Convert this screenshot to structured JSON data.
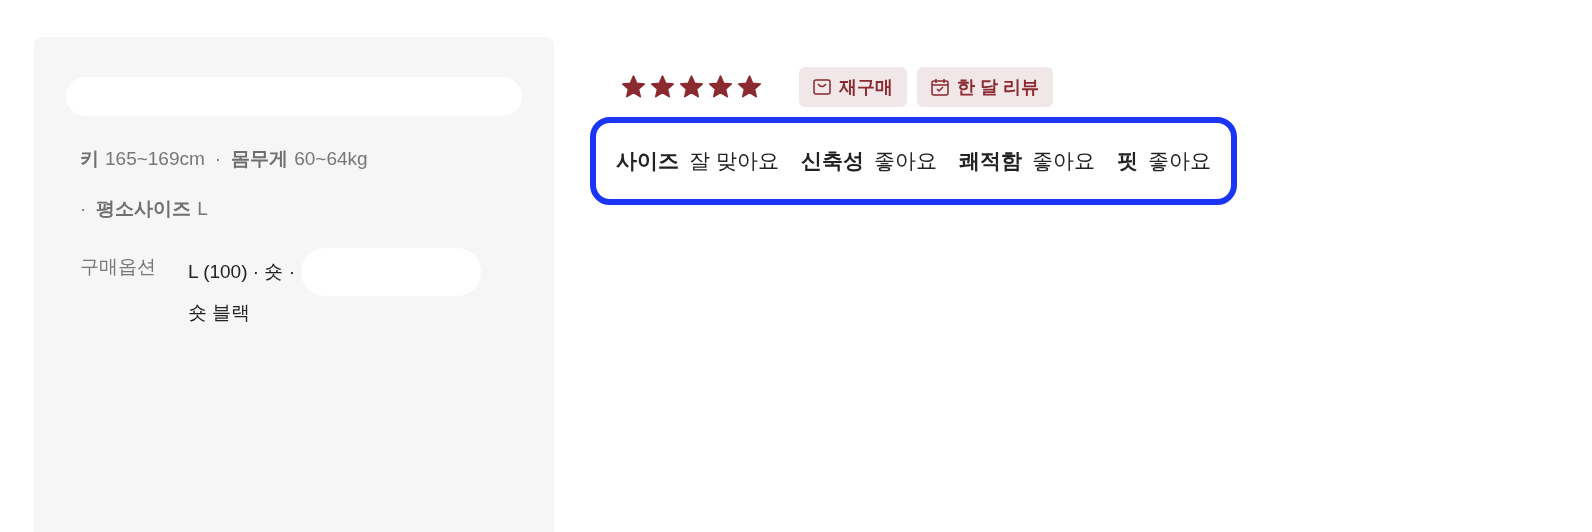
{
  "profile": {
    "stats": [
      {
        "label": "키",
        "value": "165~169cm"
      },
      {
        "separator": "·",
        "label": "몸무게",
        "value": "60~64kg"
      },
      {
        "separator": "·",
        "label": "평소사이즈",
        "value": "L"
      }
    ],
    "option": {
      "label": "구매옵션",
      "value_line_1": "L (100) · 숏 ·",
      "value_line_2": "숏 블랙"
    }
  },
  "review": {
    "stars": 5,
    "badges": [
      {
        "kind": "bag",
        "label": "재구매"
      },
      {
        "kind": "calendar",
        "label": "한 달 리뷰"
      }
    ],
    "evaluations": [
      {
        "name": "사이즈",
        "value": "잘 맞아요"
      },
      {
        "name": "신축성",
        "value": "좋아요"
      },
      {
        "name": "쾌적함",
        "value": "좋아요"
      },
      {
        "name": "핏",
        "value": "좋아요"
      }
    ]
  }
}
